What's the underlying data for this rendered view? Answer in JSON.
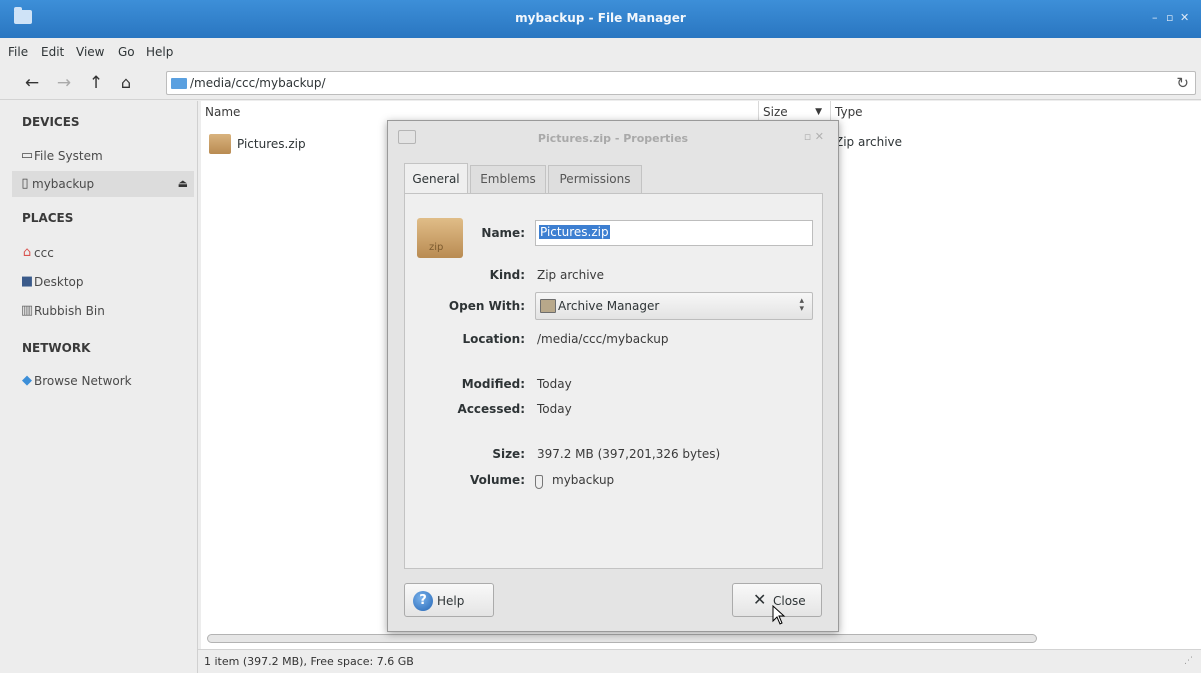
{
  "window": {
    "title": "mybackup - File Manager",
    "controls": "– ▫ ✕"
  },
  "menu": [
    "File",
    "Edit",
    "View",
    "Go",
    "Help"
  ],
  "toolbar": {
    "path": "/media/ccc/mybackup/"
  },
  "sidebar": {
    "devices_header": "DEVICES",
    "devices": [
      {
        "label": "File System",
        "icon": "drive-icon"
      },
      {
        "label": "mybackup",
        "icon": "usb-drive-icon",
        "selected": true
      }
    ],
    "places_header": "PLACES",
    "places": [
      {
        "label": "ccc",
        "icon": "home-icon"
      },
      {
        "label": "Desktop",
        "icon": "desktop-icon"
      },
      {
        "label": "Rubbish Bin",
        "icon": "trash-icon"
      }
    ],
    "network_header": "NETWORK",
    "network": [
      {
        "label": "Browse Network",
        "icon": "wifi-icon"
      }
    ]
  },
  "filelist": {
    "columns": {
      "name": "Name",
      "size": "Size",
      "type": "Type"
    },
    "rows": [
      {
        "name": "Pictures.zip",
        "type": "Zip archive"
      }
    ]
  },
  "status": "1 item (397.2 MB), Free space: 7.6 GB",
  "dialog": {
    "title": "Pictures.zip - Properties",
    "tabs": [
      "General",
      "Emblems",
      "Permissions"
    ],
    "active_tab": "General",
    "icon_label": "zip",
    "labels": {
      "name": "Name:",
      "kind": "Kind:",
      "open_with": "Open With:",
      "location": "Location:",
      "modified": "Modified:",
      "accessed": "Accessed:",
      "size": "Size:",
      "volume": "Volume:"
    },
    "values": {
      "name": "Pictures.zip",
      "kind": "Zip archive",
      "open_with": "Archive Manager",
      "location": "/media/ccc/mybackup",
      "modified": "Today",
      "accessed": "Today",
      "size": "397.2 MB (397,201,326 bytes)",
      "volume": "mybackup"
    },
    "buttons": {
      "help": "Help",
      "close": "Close"
    }
  }
}
